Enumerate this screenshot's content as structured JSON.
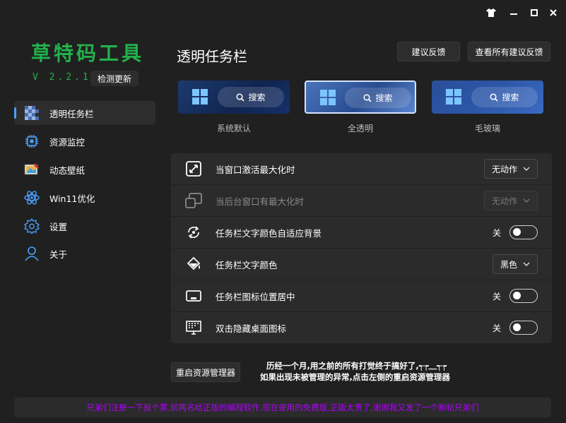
{
  "app": {
    "logo_text": "草特码工具",
    "version": "V 2.2.1.0",
    "check_update": "检测更新"
  },
  "titlebar": {
    "skin_icon": "tshirt-icon",
    "min_icon": "minimize-icon",
    "max_icon": "maximize-icon",
    "close_icon": "close-icon"
  },
  "sidebar": {
    "items": [
      {
        "label": "透明任务栏",
        "icon": "taskbar-icon",
        "active": true
      },
      {
        "label": "资源监控",
        "icon": "cpu-icon"
      },
      {
        "label": "动态壁纸",
        "icon": "wallpaper-icon"
      },
      {
        "label": "Win11优化",
        "icon": "atom-icon"
      },
      {
        "label": "设置",
        "icon": "gear-icon"
      },
      {
        "label": "关于",
        "icon": "person-icon"
      }
    ]
  },
  "main": {
    "title": "透明任务栏",
    "feedback_button": "建议反馈",
    "view_feedback_button": "查看所有建议反馈",
    "presets": [
      {
        "label": "系统默认",
        "search": "搜索"
      },
      {
        "label": "全透明",
        "search": "搜索",
        "selected": true
      },
      {
        "label": "毛玻璃",
        "search": "搜索"
      }
    ],
    "settings": [
      {
        "label": "当窗口激活最大化时",
        "icon": "maximize-window-icon",
        "control": "dropdown",
        "value": "无动作"
      },
      {
        "label": "当后台窗口有最大化时",
        "icon": "background-window-icon",
        "control": "dropdown",
        "value": "无动作",
        "disabled": true
      },
      {
        "label": "任务栏文字颜色自适应背景",
        "icon": "adaptive-color-icon",
        "control": "toggle",
        "state": "关"
      },
      {
        "label": "任务栏文字颜色",
        "icon": "paint-bucket-icon",
        "control": "dropdown",
        "value": "黑色"
      },
      {
        "label": "任务栏图标位置居中",
        "icon": "center-icon",
        "control": "toggle",
        "state": "关"
      },
      {
        "label": "双击隐藏桌面图标",
        "icon": "desktop-icon",
        "control": "toggle",
        "state": "关"
      }
    ],
    "restart_button": "重启资源管理器",
    "note_line1": "历经一个月,用之前的所有打觉终于搞好了,┭┮﹏┭┮",
    "note_line2": "如果出现未被管理的异常,点击左侧的重启资源管理器"
  },
  "footer": {
    "text": "兄弟们注册一下投个票,前两名给正版的编程软件,现在使用的免费版,正版太贵了,谢谢我又发了一个新帖兄弟们"
  },
  "colors": {
    "accent": "#4aa0ff",
    "logo": "#22b14c",
    "footer_text": "#b000ff",
    "bg": "#202020"
  }
}
